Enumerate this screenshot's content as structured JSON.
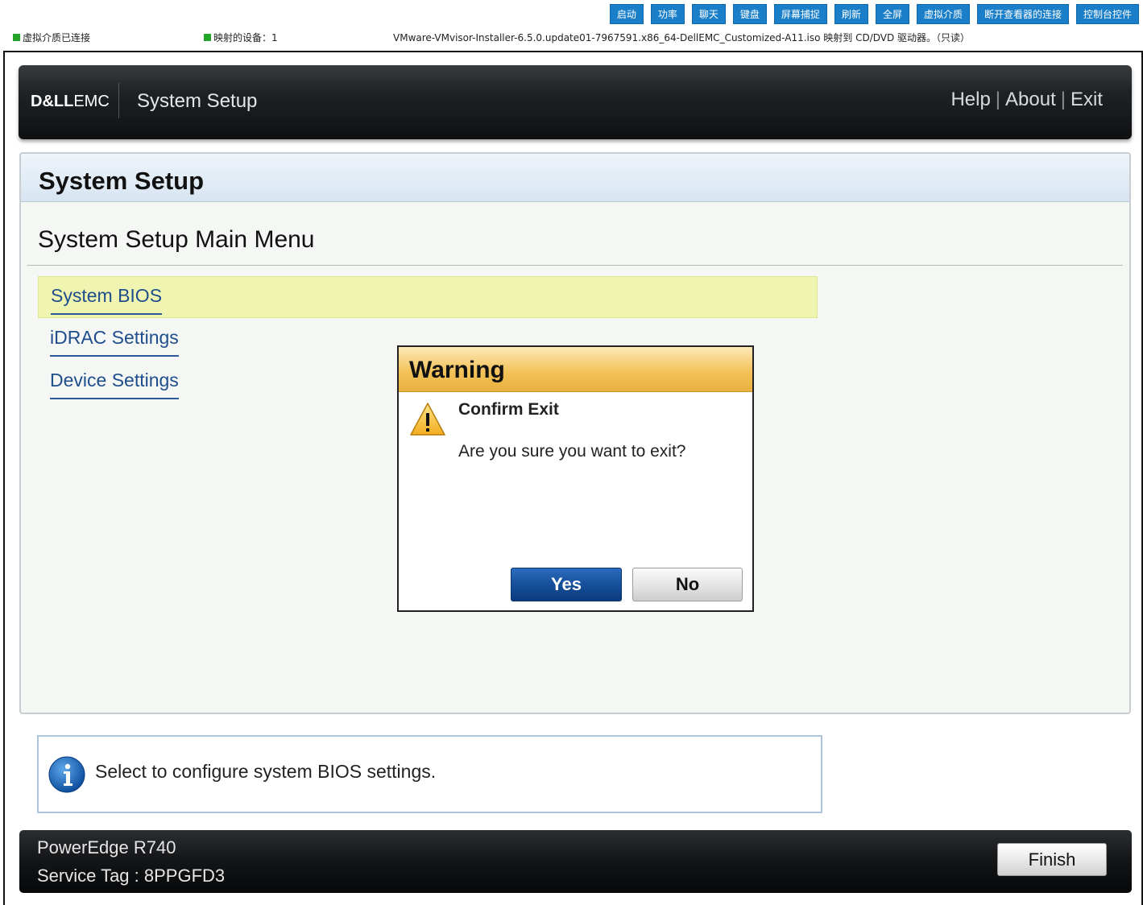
{
  "viewer_toolbar": {
    "buttons": [
      "启动",
      "功率",
      "聊天",
      "键盘",
      "屏幕捕捉",
      "刷新",
      "全屏",
      "虚拟介质",
      "断开查看器的连接",
      "控制台控件"
    ],
    "status_connected": "虚拟介质已连接",
    "status_mapped_devices": "映射的设备：1",
    "status_iso": "VMware-VMvisor-Installer-6.5.0.update01-7967591.x86_64-DellEMC_Customized-A11.iso 映射到 CD/DVD 驱动器。（只读）",
    "status_color": "#22a52a",
    "button_color": "#1a7fc8"
  },
  "header": {
    "logo_dell": "D&LL",
    "logo_emc": "EMC",
    "title": "System Setup",
    "links": [
      "Help",
      "About",
      "Exit"
    ],
    "separator": "|"
  },
  "panel": {
    "title": "System Setup",
    "menu_title": "System Setup Main Menu",
    "menu_items": [
      {
        "label": "System BIOS",
        "selected": true
      },
      {
        "label": "iDRAC Settings",
        "selected": false
      },
      {
        "label": "Device Settings",
        "selected": false
      }
    ],
    "selected_color": "#eff4b0"
  },
  "help": {
    "icon": "info-icon",
    "text": "Select to configure system BIOS settings."
  },
  "footer": {
    "model": "PowerEdge R740",
    "service_tag": "Service Tag : 8PPGFD3",
    "finish_label": "Finish"
  },
  "dialog": {
    "title": "Warning",
    "icon": "warning-icon",
    "heading": "Confirm Exit",
    "message": "Are you sure you want to exit?",
    "yes_label": "Yes",
    "no_label": "No",
    "header_color": "#f3c35a",
    "yes_color": "#164f9a"
  }
}
